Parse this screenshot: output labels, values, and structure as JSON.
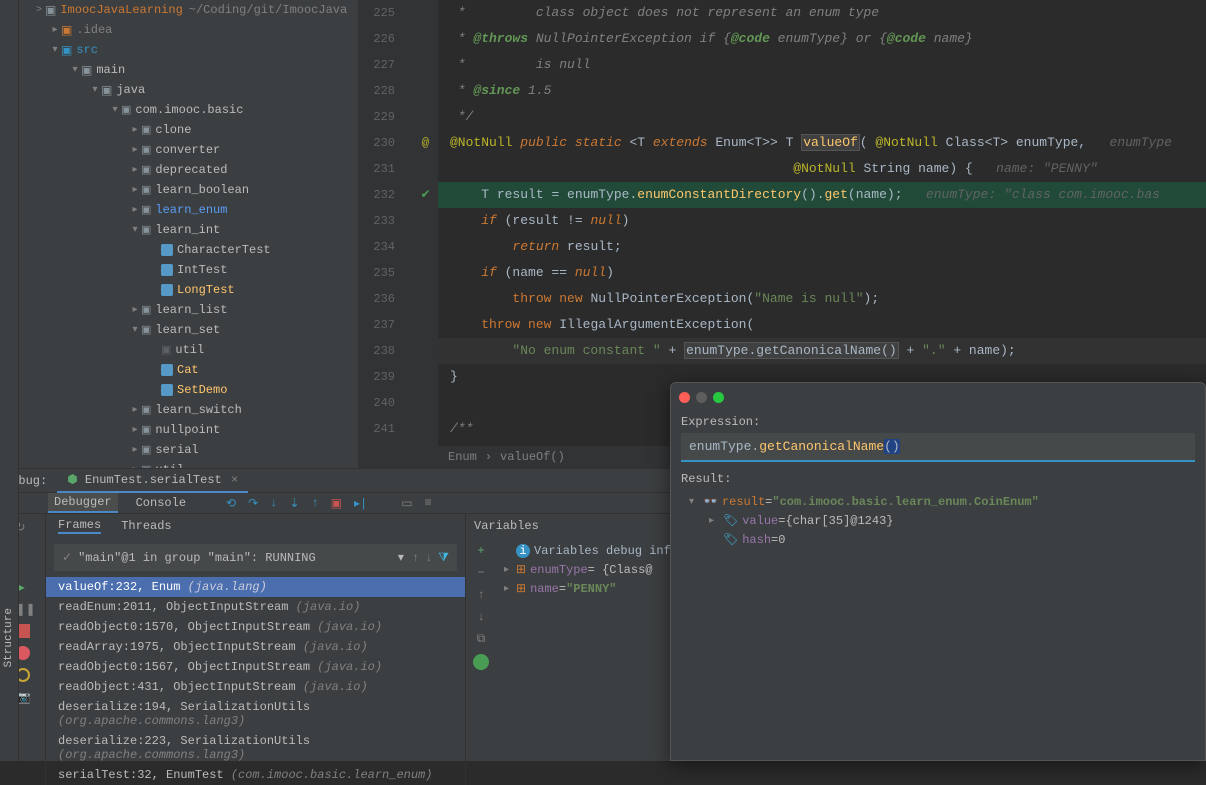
{
  "project": {
    "root": "ImoocJavaLearning",
    "root_path": "~/Coding/git/ImoocJava",
    "tree": [
      {
        "indent": 30,
        "chev": ">",
        "icon": "dir-hl",
        "label": ".idea"
      },
      {
        "indent": 30,
        "chev": "v",
        "icon": "dir-src",
        "label": "src"
      },
      {
        "indent": 50,
        "chev": "v",
        "icon": "dir",
        "label": "main"
      },
      {
        "indent": 70,
        "chev": "v",
        "icon": "dir",
        "label": "java"
      },
      {
        "indent": 90,
        "chev": "v",
        "icon": "pkg",
        "label": "com.imooc.basic"
      },
      {
        "indent": 110,
        "chev": ">",
        "icon": "pkg",
        "label": "clone"
      },
      {
        "indent": 110,
        "chev": ">",
        "icon": "pkg",
        "label": "converter"
      },
      {
        "indent": 110,
        "chev": ">",
        "icon": "pkg",
        "label": "deprecated"
      },
      {
        "indent": 110,
        "chev": ">",
        "icon": "pkg",
        "label": "learn_boolean"
      },
      {
        "indent": 110,
        "chev": ">",
        "icon": "pkg-hl",
        "label": "learn_enum"
      },
      {
        "indent": 110,
        "chev": "v",
        "icon": "pkg",
        "label": "learn_int"
      },
      {
        "indent": 130,
        "chev": "",
        "icon": "class",
        "label": "CharacterTest"
      },
      {
        "indent": 130,
        "chev": "",
        "icon": "class",
        "label": "IntTest"
      },
      {
        "indent": 130,
        "chev": "",
        "icon": "class-hl",
        "label": "LongTest"
      },
      {
        "indent": 110,
        "chev": ">",
        "icon": "pkg",
        "label": "learn_list"
      },
      {
        "indent": 110,
        "chev": "v",
        "icon": "pkg",
        "label": "learn_set"
      },
      {
        "indent": 130,
        "chev": "",
        "icon": "pkg-grey",
        "label": "util"
      },
      {
        "indent": 130,
        "chev": "",
        "icon": "class-hl",
        "label": "Cat"
      },
      {
        "indent": 130,
        "chev": "",
        "icon": "class-hl",
        "label": "SetDemo"
      },
      {
        "indent": 110,
        "chev": ">",
        "icon": "pkg",
        "label": "learn_switch"
      },
      {
        "indent": 110,
        "chev": ">",
        "icon": "pkg",
        "label": "nullpoint"
      },
      {
        "indent": 110,
        "chev": ">",
        "icon": "pkg",
        "label": "serial"
      },
      {
        "indent": 110,
        "chev": ">",
        "icon": "pkg",
        "label": "util"
      }
    ]
  },
  "editor": {
    "lines": [
      225,
      226,
      227,
      228,
      229,
      230,
      231,
      232,
      233,
      234,
      235,
      236,
      237,
      238,
      239,
      240,
      241
    ],
    "markers": {
      "230": "@",
      "232": "ok"
    },
    "breadcrumb": [
      "Enum",
      "valueOf()"
    ]
  },
  "debug": {
    "title": "Debug:",
    "config": "EnumTest.serialTest",
    "tabs": {
      "debugger": "Debugger",
      "console": "Console"
    },
    "frames_tabs": {
      "frames": "Frames",
      "threads": "Threads"
    },
    "thread_select": "\"main\"@1 in group \"main\": RUNNING",
    "frames": [
      {
        "m": "valueOf:232, Enum",
        "pkg": "(java.lang)",
        "sel": true
      },
      {
        "m": "readEnum:2011, ObjectInputStream",
        "pkg": "(java.io)"
      },
      {
        "m": "readObject0:1570, ObjectInputStream",
        "pkg": "(java.io)"
      },
      {
        "m": "readArray:1975, ObjectInputStream",
        "pkg": "(java.io)"
      },
      {
        "m": "readObject0:1567, ObjectInputStream",
        "pkg": "(java.io)"
      },
      {
        "m": "readObject:431, ObjectInputStream",
        "pkg": "(java.io)"
      },
      {
        "m": "deserialize:194, SerializationUtils",
        "pkg": "(org.apache.commons.lang3)"
      },
      {
        "m": "deserialize:223, SerializationUtils",
        "pkg": "(org.apache.commons.lang3)"
      },
      {
        "m": "serialTest:32, EnumTest",
        "pkg": "(com.imooc.basic.learn_enum)"
      }
    ],
    "vars_title": "Variables",
    "vars_info": "Variables debug info",
    "vars": [
      {
        "name": "enumType",
        "val": "= {Class@"
      },
      {
        "name": "name",
        "val": "= ",
        "str": "\"PENNY\""
      }
    ]
  },
  "eval": {
    "title": "Expression:",
    "input_parts": {
      "p1": "enumType",
      "p2": ".",
      "p3": "getCanonicalName",
      "p4": "()"
    },
    "result_label": "Result:",
    "results": [
      {
        "indent": 0,
        "chev": "v",
        "name": "result",
        "eq": " = ",
        "str": "\"com.imooc.basic.learn_enum.CoinEnum\"",
        "icon": "glasses"
      },
      {
        "indent": 20,
        "chev": ">",
        "name": "value",
        "eq": " = ",
        "val": "{char[35]@1243}",
        "icon": "tag"
      },
      {
        "indent": 20,
        "chev": "",
        "name": "hash",
        "eq": " = ",
        "val": "0",
        "icon": "tag"
      }
    ]
  },
  "structure_label": "Structure"
}
